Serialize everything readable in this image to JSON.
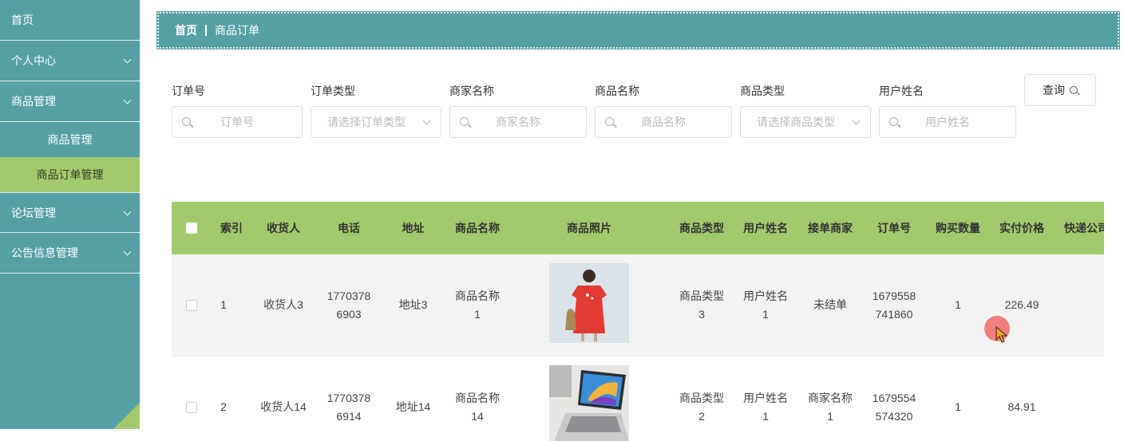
{
  "sidebar": {
    "items": [
      {
        "label": "首页"
      },
      {
        "label": "个人中心"
      },
      {
        "label": "商品管理"
      },
      {
        "label": "商品管理"
      },
      {
        "label": "商品订单管理"
      },
      {
        "label": "论坛管理"
      },
      {
        "label": "公告信息管理"
      }
    ]
  },
  "breadcrumb": {
    "home": "首页",
    "current": "商品订单"
  },
  "search": {
    "fields": [
      {
        "label": "订单号",
        "placeholder": "订单号"
      },
      {
        "label": "订单类型",
        "placeholder": "请选择订单类型"
      },
      {
        "label": "商家名称",
        "placeholder": "商家名称"
      },
      {
        "label": "商品名称",
        "placeholder": "商品名称"
      },
      {
        "label": "商品类型",
        "placeholder": "请选择商品类型"
      },
      {
        "label": "用户姓名",
        "placeholder": "用户姓名"
      }
    ],
    "query_label": "查询"
  },
  "table": {
    "headers": [
      "索引",
      "收货人",
      "电话",
      "地址",
      "商品名称",
      "商品照片",
      "商品类型",
      "用户姓名",
      "接单商家",
      "订单号",
      "购买数量",
      "实付价格",
      "快递公司"
    ],
    "rows": [
      {
        "index": "1",
        "receiver": "收货人3",
        "phone_a": "1770378",
        "phone_b": "6903",
        "address": "地址3",
        "name_a": "商品名称",
        "name_b": "1",
        "type_a": "商品类型",
        "type_b": "3",
        "user_a": "用户姓名",
        "user_b": "1",
        "merchant_a": "未结单",
        "merchant_b": "",
        "order_a": "1679558",
        "order_b": "741860",
        "qty": "1",
        "price": "226.49"
      },
      {
        "index": "2",
        "receiver": "收货人14",
        "phone_a": "1770378",
        "phone_b": "6914",
        "address": "地址14",
        "name_a": "商品名称",
        "name_b": "14",
        "type_a": "商品类型",
        "type_b": "2",
        "user_a": "用户姓名",
        "user_b": "1",
        "merchant_a": "商家名称",
        "merchant_b": "1",
        "order_a": "1679554",
        "order_b": "574320",
        "qty": "1",
        "price": "84.91"
      }
    ]
  },
  "colors": {
    "teal": "#56a0a6",
    "green": "#a3c96d"
  }
}
